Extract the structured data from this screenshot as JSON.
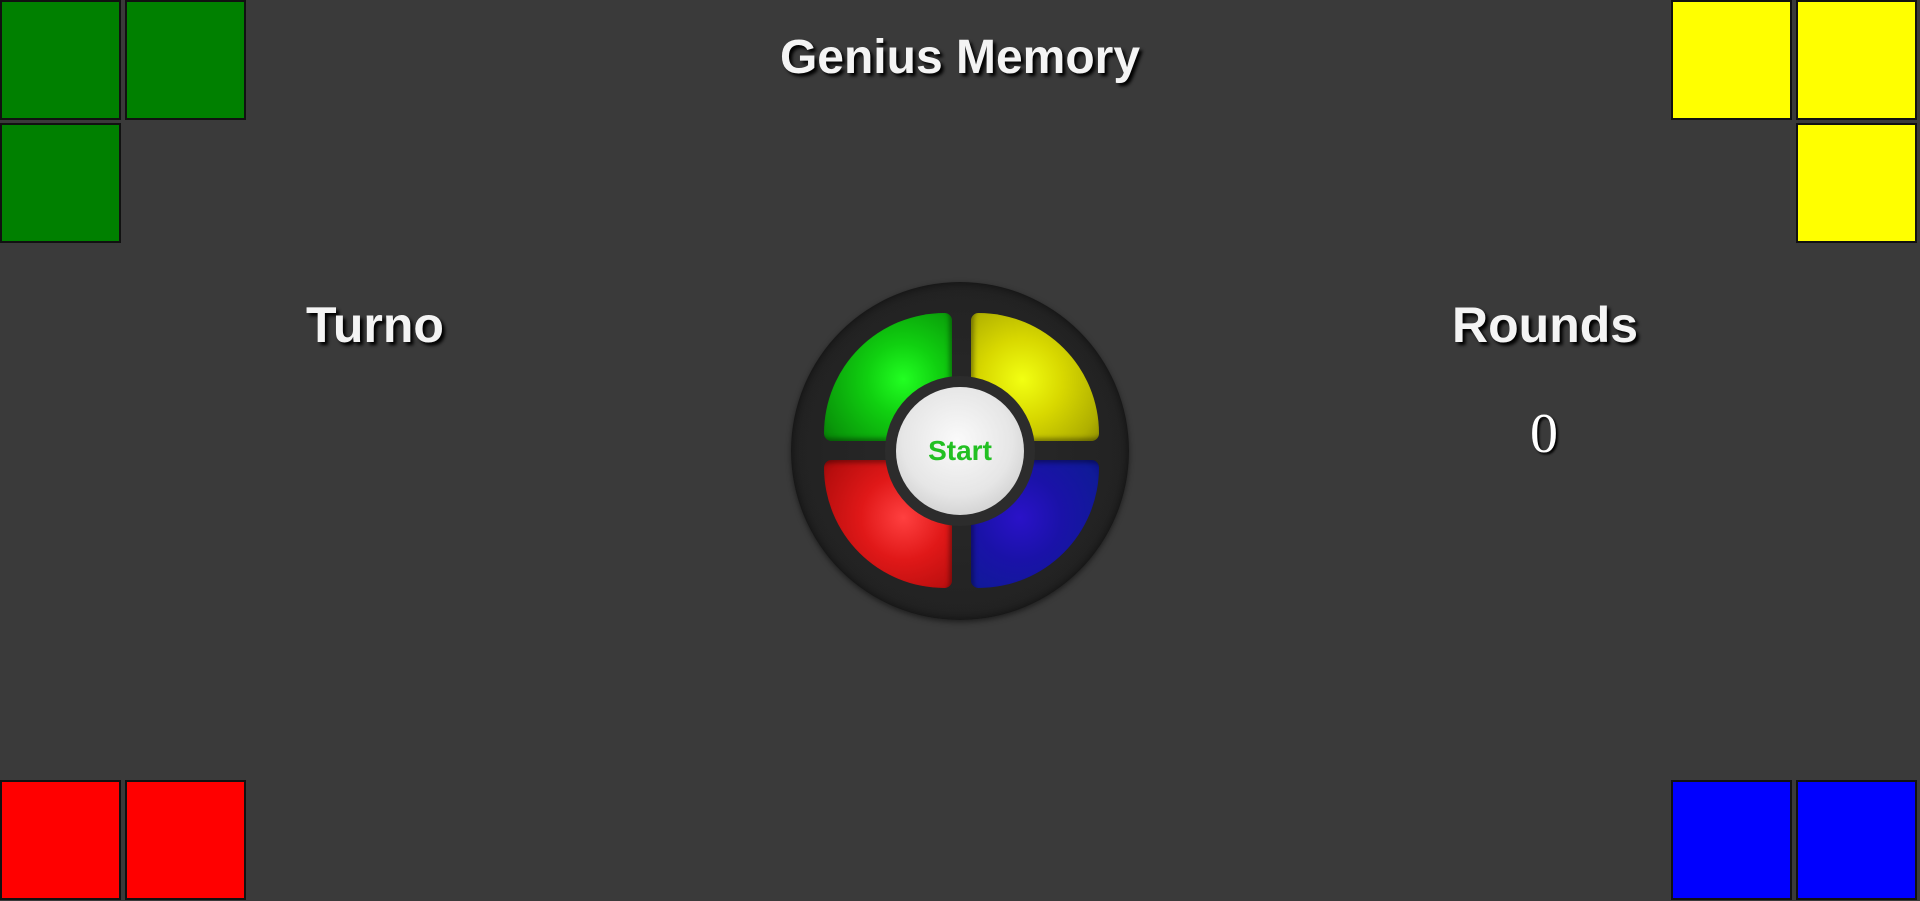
{
  "header": {
    "title": "Genius Memory"
  },
  "turn": {
    "label": "Turno"
  },
  "rounds": {
    "label": "Rounds",
    "value": "0"
  },
  "board": {
    "start_label": "Start",
    "pads": [
      {
        "color_name": "green",
        "color": "#10d010"
      },
      {
        "color_name": "yellow",
        "color": "#d8d800"
      },
      {
        "color_name": "red",
        "color": "#e01818"
      },
      {
        "color_name": "blue",
        "color": "#1a12a8"
      }
    ]
  },
  "corner_tiles": {
    "top_left": {
      "color": "#008000",
      "count": 3
    },
    "top_right": {
      "color": "#ffff00",
      "count": 3
    },
    "bottom_left": {
      "color": "#ff0000",
      "count": 2
    },
    "bottom_right": {
      "color": "#0000ff",
      "count": 2
    }
  }
}
